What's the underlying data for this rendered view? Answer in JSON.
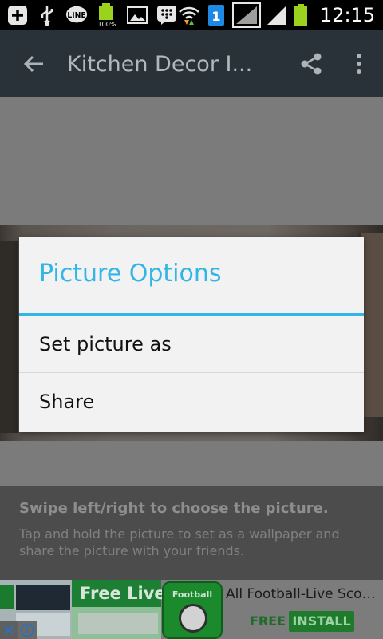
{
  "status_bar": {
    "icons": [
      "plus-icon",
      "usb-icon",
      "line-app-icon",
      "battery-full-icon",
      "gallery-icon",
      "bbm-icon",
      "wifi-icon",
      "sim1-icon",
      "signal-icon",
      "signal-icon",
      "battery-icon"
    ],
    "battery_percent_label": "100%",
    "sim_label": "1",
    "time": "12:15"
  },
  "app_bar": {
    "title": "Kitchen Decor I..."
  },
  "help": {
    "heading": "Swipe left/right to choose the picture.",
    "body": "Tap and hold the picture to set as a wallpaper and share the picture with your friends."
  },
  "dialog": {
    "title": "Picture Options",
    "items": [
      {
        "label": "Set picture as"
      },
      {
        "label": "Share"
      }
    ]
  },
  "ad": {
    "banner_text": "Free Live",
    "logo_text": "Football",
    "app_name": "All Football-Live Scor...",
    "price": "FREE",
    "install_label": "INSTALL"
  },
  "colors": {
    "accent": "#33b5e5",
    "status_bar": "#000000",
    "app_bar": "#283238"
  }
}
